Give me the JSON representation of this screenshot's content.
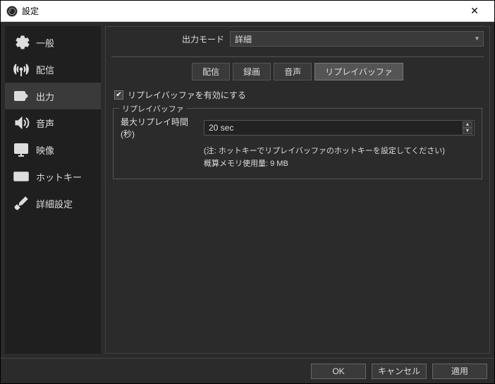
{
  "window": {
    "title": "設定"
  },
  "sidebar": {
    "items": [
      {
        "label": "一般"
      },
      {
        "label": "配信"
      },
      {
        "label": "出力"
      },
      {
        "label": "音声"
      },
      {
        "label": "映像"
      },
      {
        "label": "ホットキー"
      },
      {
        "label": "詳細設定"
      }
    ]
  },
  "output_mode": {
    "label": "出力モード",
    "value": "詳細"
  },
  "tabs": {
    "items": [
      {
        "label": "配信"
      },
      {
        "label": "録画"
      },
      {
        "label": "音声"
      },
      {
        "label": "リプレイバッファ"
      }
    ]
  },
  "replay": {
    "enable_label": "リプレイバッファを有効にする",
    "group_title": "リプレイバッファ",
    "max_time_label": "最大リプレイ時間 (秒)",
    "max_time_value": "20 sec",
    "note1": "(注: ホットキーでリプレイバッファのホットキーを設定してください)",
    "note2": "概算メモリ使用量: 9 MB"
  },
  "footer": {
    "ok": "OK",
    "cancel": "キャンセル",
    "apply": "適用"
  }
}
